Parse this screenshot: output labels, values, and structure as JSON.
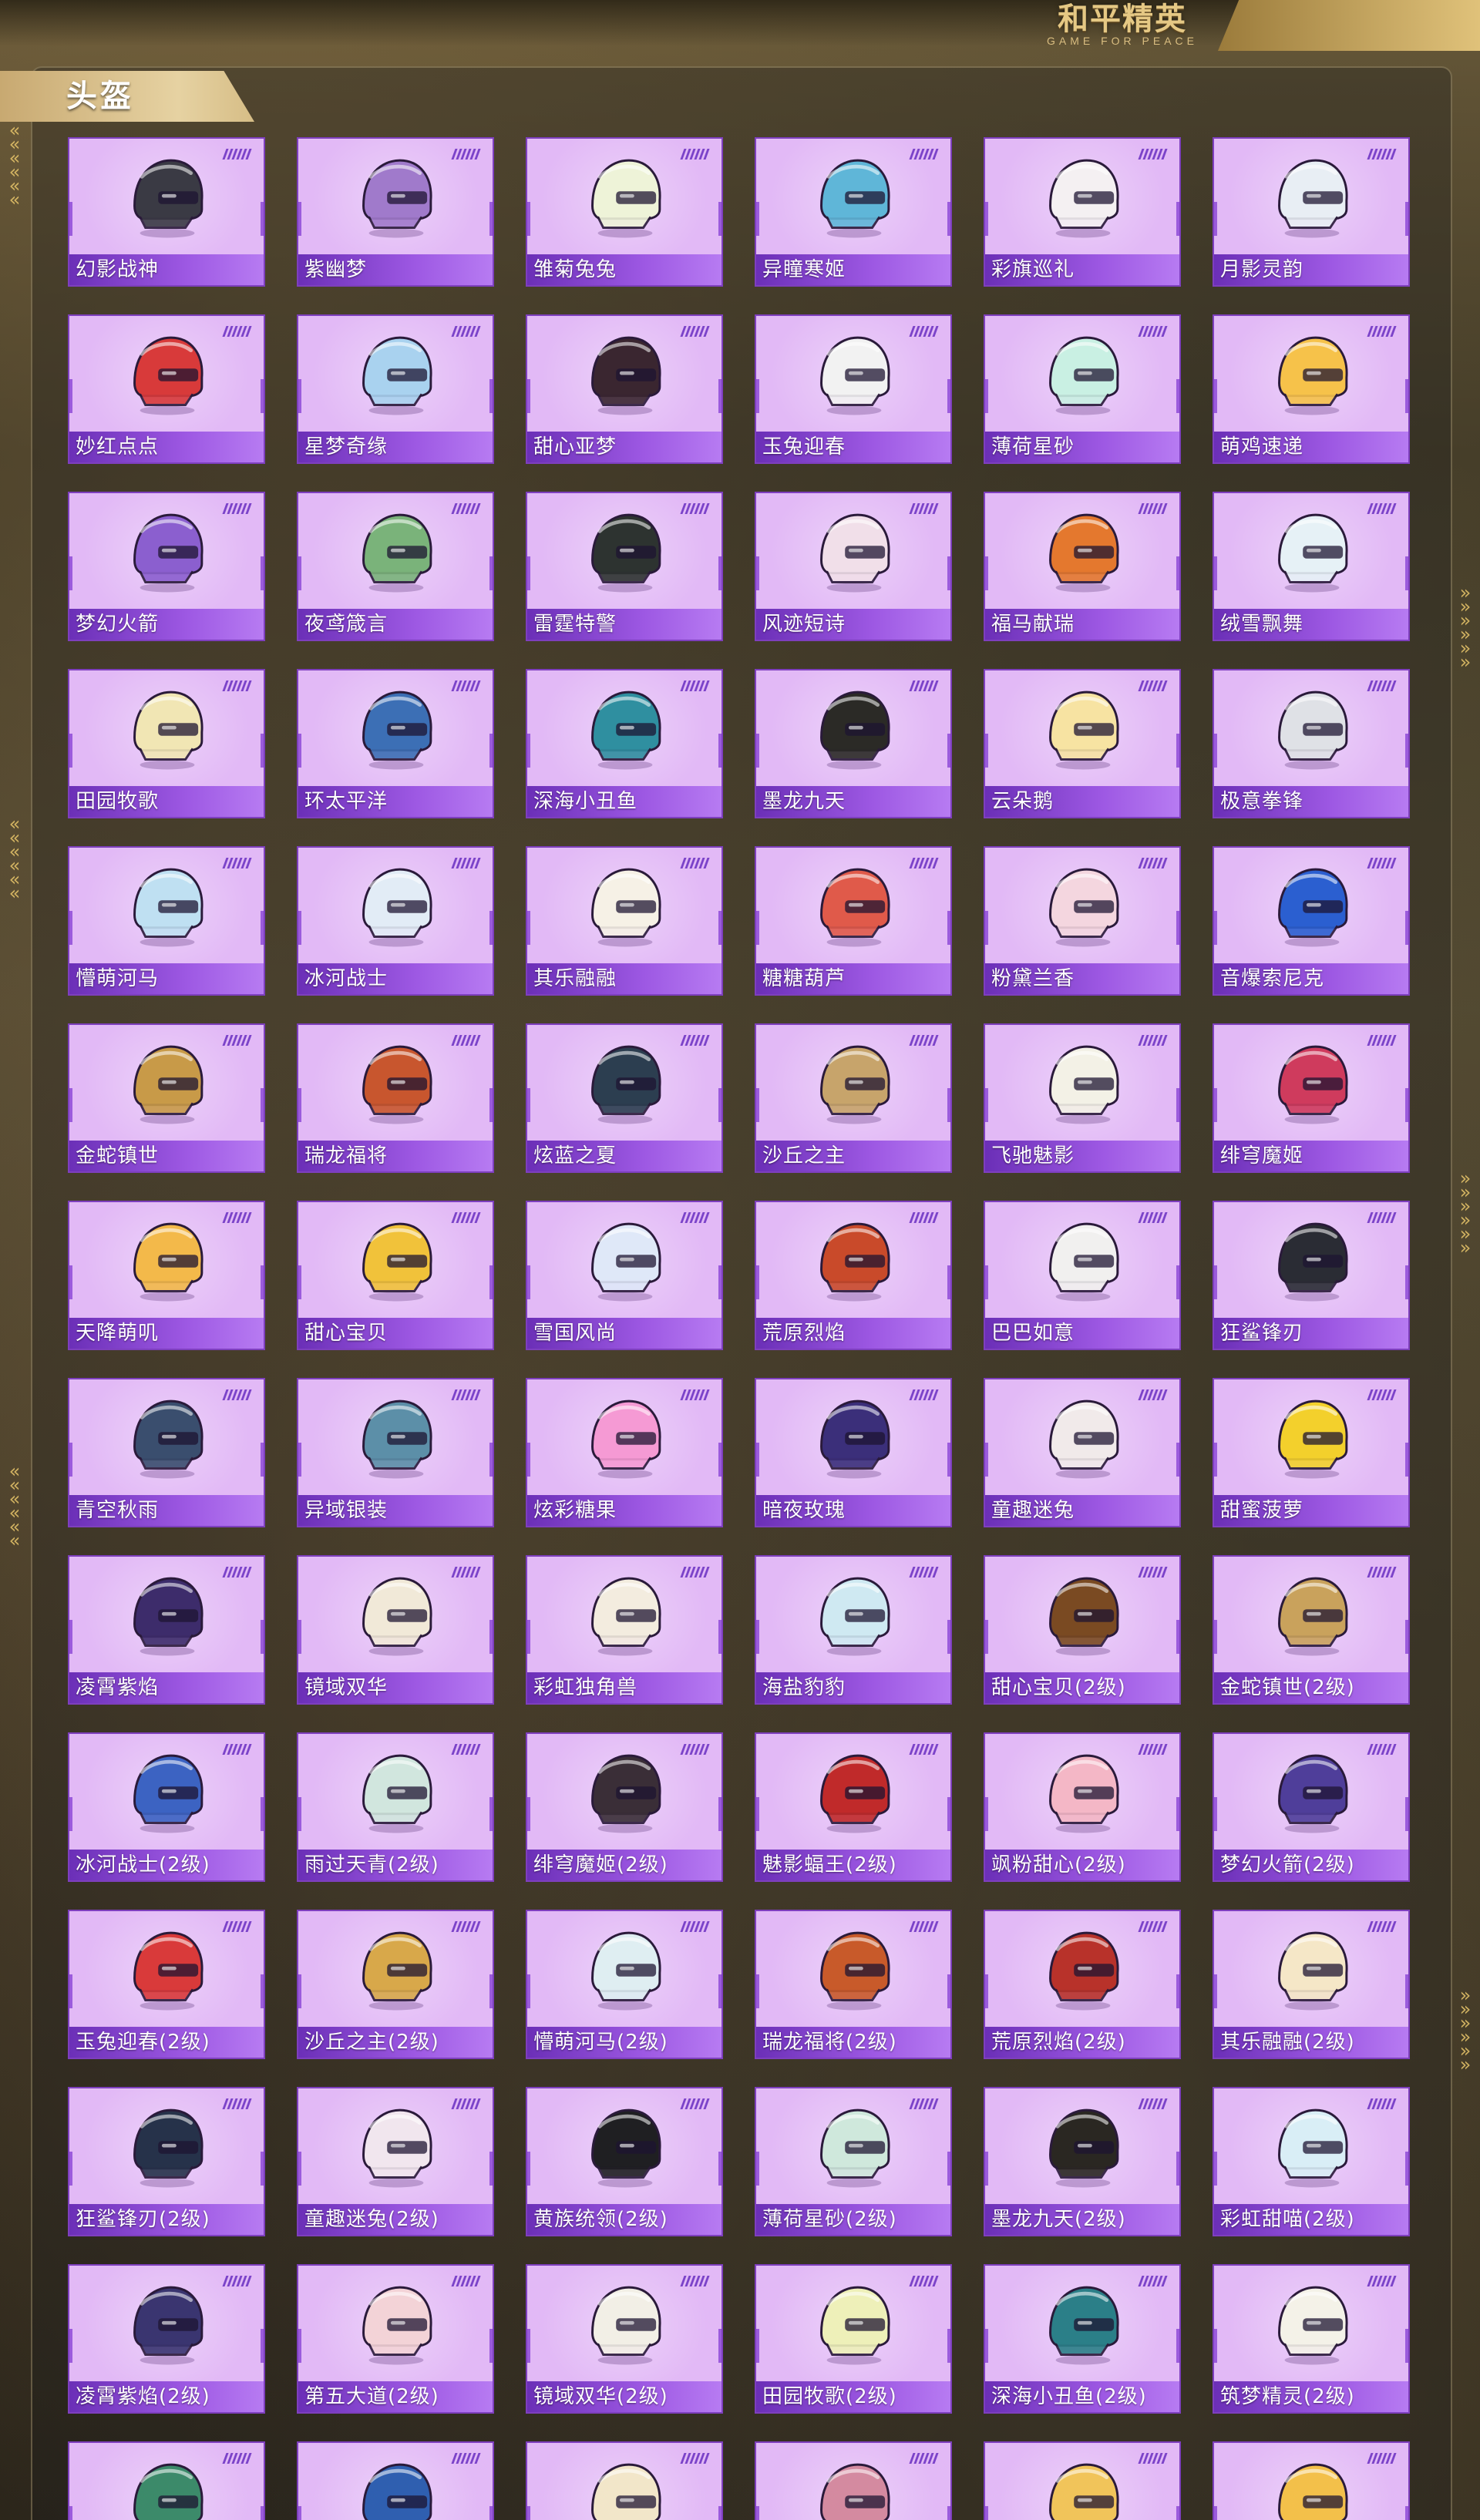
{
  "brand": {
    "logo_main": "和平精英",
    "logo_sub": "GAME FOR PEACE"
  },
  "section": {
    "title": "头盔"
  },
  "colors": {
    "card_bg": "#e2b9f6",
    "card_border": "#7e3fbe",
    "label_bar": "#8a47d4",
    "tag_gold": "#d6bd86"
  },
  "items": [
    {
      "name": "幻影战神",
      "icon": "helmet-icon",
      "color": "#3a3a44"
    },
    {
      "name": "紫幽梦",
      "icon": "helmet-icon",
      "color": "#a07acb"
    },
    {
      "name": "雏菊兔兔",
      "icon": "helmet-icon",
      "color": "#eef3d8"
    },
    {
      "name": "异瞳寒姬",
      "icon": "helmet-icon",
      "color": "#5fb6d8"
    },
    {
      "name": "彩旗巡礼",
      "icon": "helmet-icon",
      "color": "#f4f0f2"
    },
    {
      "name": "月影灵韵",
      "icon": "helmet-icon",
      "color": "#e8eef4"
    },
    {
      "name": "妙红点点",
      "icon": "helmet-icon",
      "color": "#d83a3a"
    },
    {
      "name": "星梦奇缘",
      "icon": "helmet-icon",
      "color": "#a9d2ef"
    },
    {
      "name": "甜心亚梦",
      "icon": "helmet-icon",
      "color": "#3a2630"
    },
    {
      "name": "玉兔迎春",
      "icon": "helmet-icon",
      "color": "#f2f2f2"
    },
    {
      "name": "薄荷星砂",
      "icon": "helmet-icon",
      "color": "#c9f0e3"
    },
    {
      "name": "萌鸡速递",
      "icon": "helmet-icon",
      "color": "#f6c24a"
    },
    {
      "name": "梦幻火箭",
      "icon": "helmet-icon",
      "color": "#8b5fcf"
    },
    {
      "name": "夜鸢箴言",
      "icon": "helmet-icon",
      "color": "#7ab37a"
    },
    {
      "name": "雷霆特警",
      "icon": "helmet-icon",
      "color": "#2d3330"
    },
    {
      "name": "风迹短诗",
      "icon": "helmet-icon",
      "color": "#f1dfe9"
    },
    {
      "name": "福马献瑞",
      "icon": "helmet-icon",
      "color": "#e4782e"
    },
    {
      "name": "绒雪飘舞",
      "icon": "helmet-icon",
      "color": "#e6f1f6"
    },
    {
      "name": "田园牧歌",
      "icon": "helmet-icon",
      "color": "#f1e6b4"
    },
    {
      "name": "环太平洋",
      "icon": "helmet-icon",
      "color": "#3c6fb5"
    },
    {
      "name": "深海小丑鱼",
      "icon": "helmet-icon",
      "color": "#2f8fa0"
    },
    {
      "name": "墨龙九天",
      "icon": "helmet-icon",
      "color": "#2b2a26"
    },
    {
      "name": "云朵鹅",
      "icon": "helmet-icon",
      "color": "#f7e3a2"
    },
    {
      "name": "极意拳锋",
      "icon": "helmet-icon",
      "color": "#dfe1e6"
    },
    {
      "name": "懵萌河马",
      "icon": "helmet-icon",
      "color": "#bfe0f2"
    },
    {
      "name": "冰河战士",
      "icon": "helmet-icon",
      "color": "#e2ecf6"
    },
    {
      "name": "其乐融融",
      "icon": "helmet-icon",
      "color": "#f6f1e6"
    },
    {
      "name": "糖糖葫芦",
      "icon": "helmet-icon",
      "color": "#e05a4a"
    },
    {
      "name": "粉黛兰香",
      "icon": "helmet-icon",
      "color": "#f4d6df"
    },
    {
      "name": "音爆索尼克",
      "icon": "helmet-icon",
      "color": "#2b5fd0"
    },
    {
      "name": "金蛇镇世",
      "icon": "helmet-icon",
      "color": "#c89a48"
    },
    {
      "name": "瑞龙福将",
      "icon": "helmet-icon",
      "color": "#c8562e"
    },
    {
      "name": "炫蓝之夏",
      "icon": "helmet-icon",
      "color": "#2c3e50"
    },
    {
      "name": "沙丘之主",
      "icon": "helmet-icon",
      "color": "#c7a46b"
    },
    {
      "name": "飞驰魅影",
      "icon": "helmet-icon",
      "color": "#f3f1e6"
    },
    {
      "name": "绯穹魔姬",
      "icon": "helmet-icon",
      "color": "#cf3b5d"
    },
    {
      "name": "天降萌叽",
      "icon": "helmet-icon",
      "color": "#f3b94a"
    },
    {
      "name": "甜心宝贝",
      "icon": "helmet-icon",
      "color": "#f1c23a"
    },
    {
      "name": "雪国风尚",
      "icon": "helmet-icon",
      "color": "#dfe8f8"
    },
    {
      "name": "荒原烈焰",
      "icon": "helmet-icon",
      "color": "#c94a2a"
    },
    {
      "name": "巴巴如意",
      "icon": "helmet-icon",
      "color": "#f1f0ef"
    },
    {
      "name": "狂鲨锋刃",
      "icon": "helmet-icon",
      "color": "#2a2c34"
    },
    {
      "name": "青空秋雨",
      "icon": "helmet-icon",
      "color": "#3a4e6e"
    },
    {
      "name": "异域银装",
      "icon": "helmet-icon",
      "color": "#5c8fa8"
    },
    {
      "name": "炫彩糖果",
      "icon": "helmet-icon",
      "color": "#f59ad4"
    },
    {
      "name": "暗夜玫瑰",
      "icon": "helmet-icon",
      "color": "#3b2f7a"
    },
    {
      "name": "童趣迷兔",
      "icon": "helmet-icon",
      "color": "#f1eaea"
    },
    {
      "name": "甜蜜菠萝",
      "icon": "helmet-icon",
      "color": "#f3d02c"
    },
    {
      "name": "凌霄紫焰",
      "icon": "helmet-icon",
      "color": "#3d2c6b"
    },
    {
      "name": "镜域双华",
      "icon": "helmet-icon",
      "color": "#f1e9d8"
    },
    {
      "name": "彩虹独角兽",
      "icon": "helmet-icon",
      "color": "#f3ecdf"
    },
    {
      "name": "海盐豹豹",
      "icon": "helmet-icon",
      "color": "#cfe9f2"
    },
    {
      "name": "甜心宝贝(2级)",
      "icon": "helmet-icon",
      "color": "#7a4a22"
    },
    {
      "name": "金蛇镇世(2级)",
      "icon": "helmet-icon",
      "color": "#c9a25c"
    },
    {
      "name": "冰河战士(2级)",
      "icon": "helmet-icon",
      "color": "#3c63c2"
    },
    {
      "name": "雨过天青(2级)",
      "icon": "helmet-icon",
      "color": "#d1e6de"
    },
    {
      "name": "绯穹魔姬(2级)",
      "icon": "helmet-icon",
      "color": "#3a2e37"
    },
    {
      "name": "魅影蝠王(2级)",
      "icon": "helmet-icon",
      "color": "#c02a2a"
    },
    {
      "name": "飒粉甜心(2级)",
      "icon": "helmet-icon",
      "color": "#f4b7c6"
    },
    {
      "name": "梦幻火箭(2级)",
      "icon": "helmet-icon",
      "color": "#4f3e9a"
    },
    {
      "name": "玉兔迎春(2级)",
      "icon": "helmet-icon",
      "color": "#d93a3a"
    },
    {
      "name": "沙丘之主(2级)",
      "icon": "helmet-icon",
      "color": "#d8a84a"
    },
    {
      "name": "懵萌河马(2级)",
      "icon": "helmet-icon",
      "color": "#dfeef2"
    },
    {
      "name": "瑞龙福将(2级)",
      "icon": "helmet-icon",
      "color": "#c85a2a"
    },
    {
      "name": "荒原烈焰(2级)",
      "icon": "helmet-icon",
      "color": "#b8322a"
    },
    {
      "name": "其乐融融(2级)",
      "icon": "helmet-icon",
      "color": "#f5e7c7"
    },
    {
      "name": "狂鲨锋刃(2级)",
      "icon": "helmet-icon",
      "color": "#26324a"
    },
    {
      "name": "童趣迷兔(2级)",
      "icon": "helmet-icon",
      "color": "#f1e6ee"
    },
    {
      "name": "黄族统领(2级)",
      "icon": "helmet-icon",
      "color": "#1f1f22"
    },
    {
      "name": "薄荷星砂(2级)",
      "icon": "helmet-icon",
      "color": "#cfe8dc"
    },
    {
      "name": "墨龙九天(2级)",
      "icon": "helmet-icon",
      "color": "#2a2722"
    },
    {
      "name": "彩虹甜喵(2级)",
      "icon": "helmet-icon",
      "color": "#d9eef6"
    },
    {
      "name": "凌霄紫焰(2级)",
      "icon": "helmet-icon",
      "color": "#3a3570"
    },
    {
      "name": "第五大道(2级)",
      "icon": "helmet-icon",
      "color": "#f3d3d7"
    },
    {
      "name": "镜域双华(2级)",
      "icon": "helmet-icon",
      "color": "#f2efe6"
    },
    {
      "name": "田园牧歌(2级)",
      "icon": "helmet-icon",
      "color": "#eef0b9"
    },
    {
      "name": "深海小丑鱼(2级)",
      "icon": "helmet-icon",
      "color": "#2b7f88"
    },
    {
      "name": "筑梦精灵(2级)",
      "icon": "helmet-icon",
      "color": "#f4f2e8"
    },
    {
      "name": "",
      "icon": "helmet-icon",
      "color": "#3c8a6a"
    },
    {
      "name": "",
      "icon": "helmet-icon",
      "color": "#2f5fb0"
    },
    {
      "name": "",
      "icon": "helmet-icon",
      "color": "#f2e6c9"
    },
    {
      "name": "",
      "icon": "helmet-icon",
      "color": "#d48aa0"
    },
    {
      "name": "",
      "icon": "helmet-icon",
      "color": "#f1c45a"
    },
    {
      "name": "",
      "icon": "helmet-icon",
      "color": "#f3c04a"
    }
  ]
}
